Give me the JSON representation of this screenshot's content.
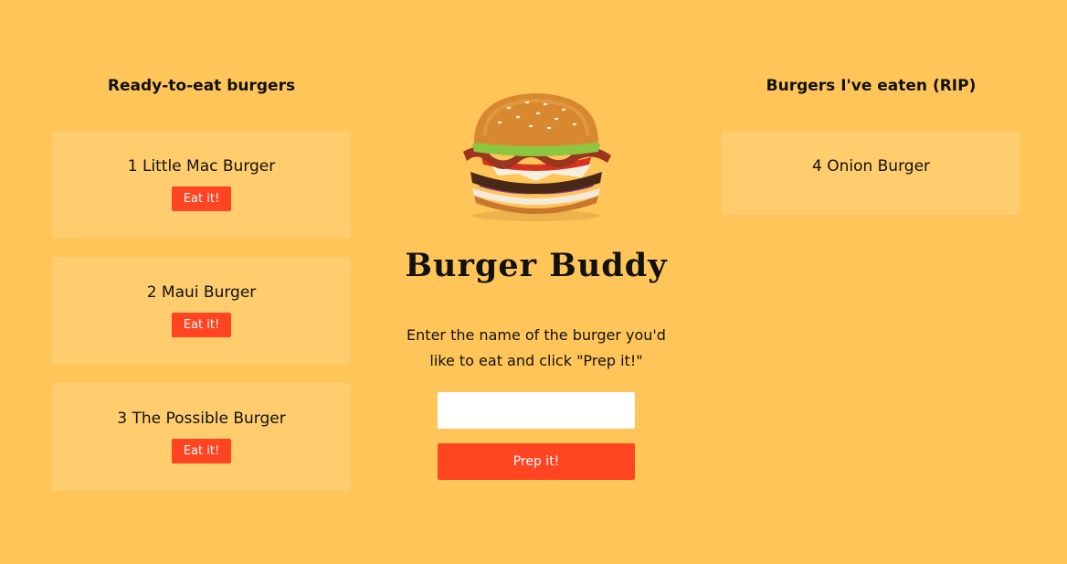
{
  "left_column": {
    "heading": "Ready-to-eat burgers",
    "burgers": [
      {
        "name": "1 Little Mac Burger",
        "button_label": "Eat it!"
      },
      {
        "name": "2 Maui Burger",
        "button_label": "Eat it!"
      },
      {
        "name": "3 The Possible Burger",
        "button_label": "Eat it!"
      }
    ]
  },
  "center": {
    "image_icon": "burger-image",
    "title": "Burger Buddy",
    "instructions": "Enter the name of the burger you'd like to eat and click \"Prep it!\"",
    "input_value": "",
    "input_placeholder": "",
    "button_label": "Prep it!"
  },
  "right_column": {
    "heading": "Burgers I've eaten (RIP)",
    "burgers": [
      {
        "name": "4 Onion Burger"
      }
    ]
  },
  "colors": {
    "background": "#FFC559",
    "card": "#FFCD6E",
    "accent": "#FF4422"
  }
}
